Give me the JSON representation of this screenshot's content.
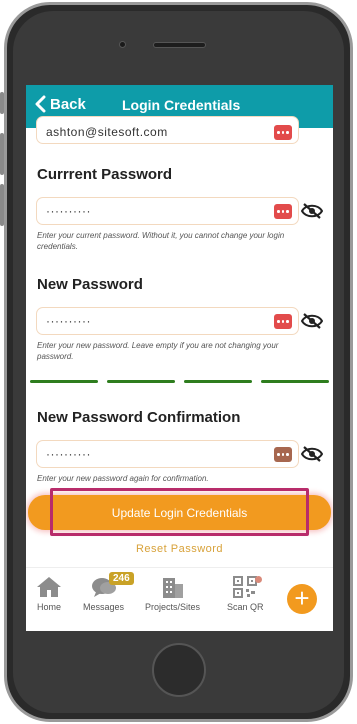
{
  "header": {
    "back_label": "Back",
    "title": "Login Credentials"
  },
  "email_field": {
    "value": "ashton@sitesoft.com"
  },
  "current_password": {
    "label": "Currrent Password",
    "value": "··········",
    "hint": "Enter your current password. Without it, you cannot change your login credentials."
  },
  "new_password": {
    "label": "New Password",
    "value": "··········",
    "hint": "Enter your new password. Leave empty if you are not changing your password."
  },
  "password_strength": {
    "filled_segments": 4,
    "total_segments": 4,
    "color": "#2e7d1e"
  },
  "confirm_password": {
    "label": "New Password Confirmation",
    "value": "··········",
    "hint": "Enter your new password again for confirmation."
  },
  "actions": {
    "update_label": "Update Login Credentials",
    "reset_label": "Reset Password"
  },
  "tabbar": {
    "home_label": "Home",
    "messages_label": "Messages",
    "messages_badge": "246",
    "projects_label": "Projects/Sites",
    "scan_label": "Scan QR",
    "fab_symbol": "+"
  },
  "colors": {
    "header_bg": "#0e9ca9",
    "accent": "#f29a1f",
    "highlight": "#b82c6b"
  }
}
